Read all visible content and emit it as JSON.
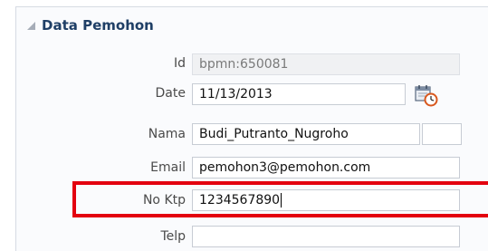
{
  "section": {
    "title": "Data Pemohon"
  },
  "fields": {
    "id": {
      "label": "Id",
      "value": "bpmn:650081"
    },
    "date": {
      "label": "Date",
      "value": "11/13/2013"
    },
    "nama": {
      "label": "Nama",
      "value": "Budi_Putranto_Nugroho"
    },
    "email": {
      "label": "Email",
      "value": "pemohon3@pemohon.com"
    },
    "noktp": {
      "label": "No Ktp",
      "value": "1234567890"
    },
    "telp": {
      "label": "Telp",
      "value": ""
    }
  },
  "colors": {
    "highlight": "#e3000f",
    "title": "#1f3f66"
  }
}
